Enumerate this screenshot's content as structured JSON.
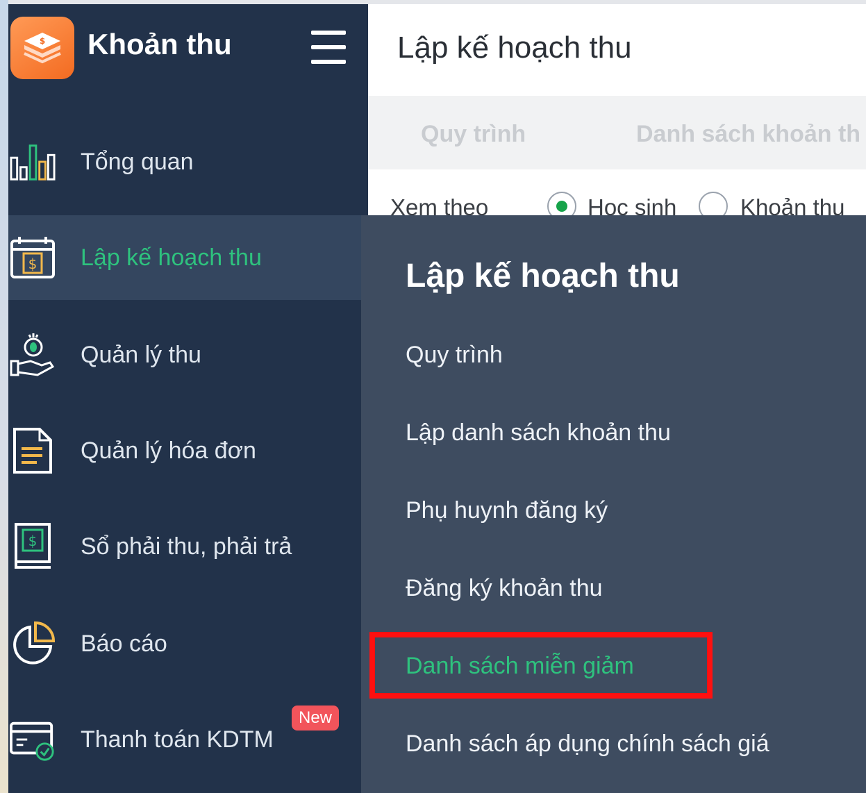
{
  "app": {
    "title": "Khoản thu"
  },
  "sidebar": {
    "items": [
      {
        "label": "Tổng quan",
        "icon": "bar-chart-icon"
      },
      {
        "label": "Lập kế hoạch thu",
        "icon": "calendar-dollar-icon",
        "active": true
      },
      {
        "label": "Quản lý thu",
        "icon": "money-hand-icon"
      },
      {
        "label": "Quản lý hóa đơn",
        "icon": "invoice-icon"
      },
      {
        "label": "Sổ phải thu, phải trả",
        "icon": "ledger-book-icon"
      },
      {
        "label": "Báo cáo",
        "icon": "pie-chart-icon"
      },
      {
        "label": "Thanh toán KDTM",
        "icon": "card-payment-icon",
        "badge": "New"
      }
    ]
  },
  "main": {
    "page_title": "Lập kế hoạch thu",
    "tabs": [
      {
        "label": "Quy trình"
      },
      {
        "label": "Danh sách khoản th"
      }
    ],
    "filter": {
      "label": "Xem theo",
      "options": [
        {
          "label": "Học sinh",
          "checked": true
        },
        {
          "label": "Khoản thu",
          "checked": false
        }
      ]
    }
  },
  "flyout": {
    "title": "Lập kế hoạch thu",
    "items": [
      {
        "label": "Quy trình"
      },
      {
        "label": "Lập danh sách khoản thu"
      },
      {
        "label": "Phụ huynh đăng ký"
      },
      {
        "label": "Đăng ký khoản thu"
      },
      {
        "label": "Danh sách miễn giảm",
        "active": true
      },
      {
        "label": "Danh sách áp dụng chính sách giá"
      }
    ]
  },
  "colors": {
    "sidebar_bg": "#22324a",
    "sidebar_active_bg": "#34465f",
    "flyout_bg": "#3e4c60",
    "accent_green": "#2ec27e",
    "highlight_red": "#ff1010",
    "brand_orange": "#f36b21"
  }
}
